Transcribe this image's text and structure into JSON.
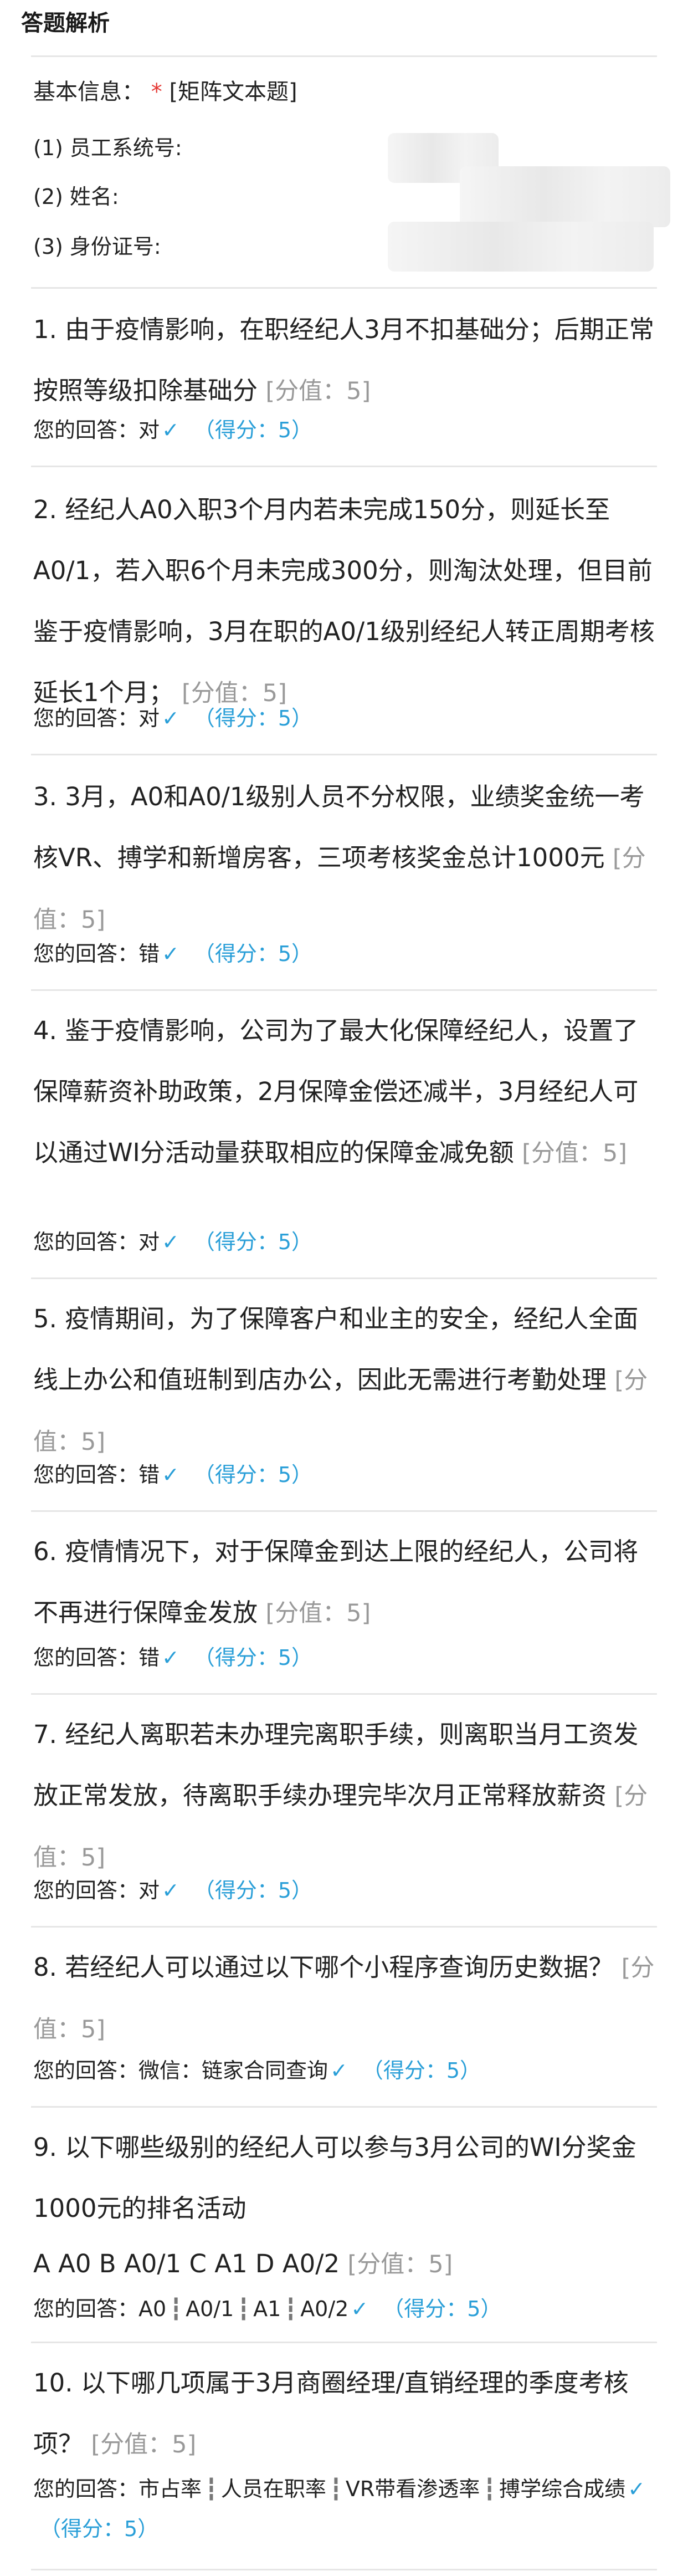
{
  "header": {
    "title": "答题解析"
  },
  "basic_info": {
    "label": "基本信息：",
    "required_mark": "*",
    "type": "[矩阵文本题]",
    "fields": [
      "(1) 员工系统号:",
      "(2) 姓名:",
      "(3) 身份证号:"
    ]
  },
  "answer_prefix": "您的回答：",
  "check_symbol": "✓",
  "questions": [
    {
      "text": "1. 由于疫情影响，在职经纪人3月不扣基础分；后期正常按照等级扣除基础分",
      "score": "[分值：5]",
      "answer": "对",
      "points": "（得分：5）"
    },
    {
      "text": "2. 经纪人A0入职3个月内若未完成150分，则延长至A0/1，若入职6个月未完成300分，则淘汰处理，但目前鉴于疫情影响，3月在职的A0/1级别经纪人转正周期考核延长1个月；",
      "score": "[分值：5]",
      "answer": "对",
      "points": "（得分：5）"
    },
    {
      "text": "3. 3月，A0和A0/1级别人员不分权限，业绩奖金统一考核VR、搏学和新增房客，三项考核奖金总计1000元",
      "score": "[分值：5]",
      "answer": "错",
      "points": "（得分：5）"
    },
    {
      "text": "4. 鉴于疫情影响，公司为了最大化保障经纪人，设置了保障薪资补助政策，2月保障金偿还减半，3月经纪人可以通过WI分活动量获取相应的保障金减免额",
      "score": "[分值：5]",
      "answer": "对",
      "points": "（得分：5）"
    },
    {
      "text": "5. 疫情期间，为了保障客户和业主的安全，经纪人全面线上办公和值班制到店办公，因此无需进行考勤处理",
      "score": "[分值：5]",
      "answer": "错",
      "points": "（得分：5）"
    },
    {
      "text": "6. 疫情情况下，对于保障金到达上限的经纪人，公司将不再进行保障金发放",
      "score": "[分值：5]",
      "answer": "错",
      "points": "（得分：5）"
    },
    {
      "text": "7. 经纪人离职若未办理完离职手续，则离职当月工资发放正常发放，待离职手续办理完毕次月正常释放薪资",
      "score": "[分值：5]",
      "answer": "对",
      "points": "（得分：5）"
    },
    {
      "text": "8. 若经纪人可以通过以下哪个小程序查询历史数据？",
      "score": "[分值：5]",
      "answer": "微信：链家合同查询",
      "points": "（得分：5）"
    },
    {
      "text": "9. 以下哪些级别的经纪人可以参与3月公司的WI分奖金1000元的排名活动",
      "options": "A A0 B A0/1 C A1 D A0/2",
      "score": "[分值：5]",
      "answer": [
        "A0",
        "A0/1",
        "A1",
        "A0/2"
      ],
      "points": "（得分：5）"
    },
    {
      "text": "10. 以下哪几项属于3月商圈经理/直销经理的季度考核项？",
      "score": "[分值：5]",
      "answer": [
        "市占率",
        "人员在职率",
        "VR带看渗透率",
        "搏学综合成绩"
      ],
      "points": "（得分：5）"
    }
  ],
  "multi_separator": "┇"
}
